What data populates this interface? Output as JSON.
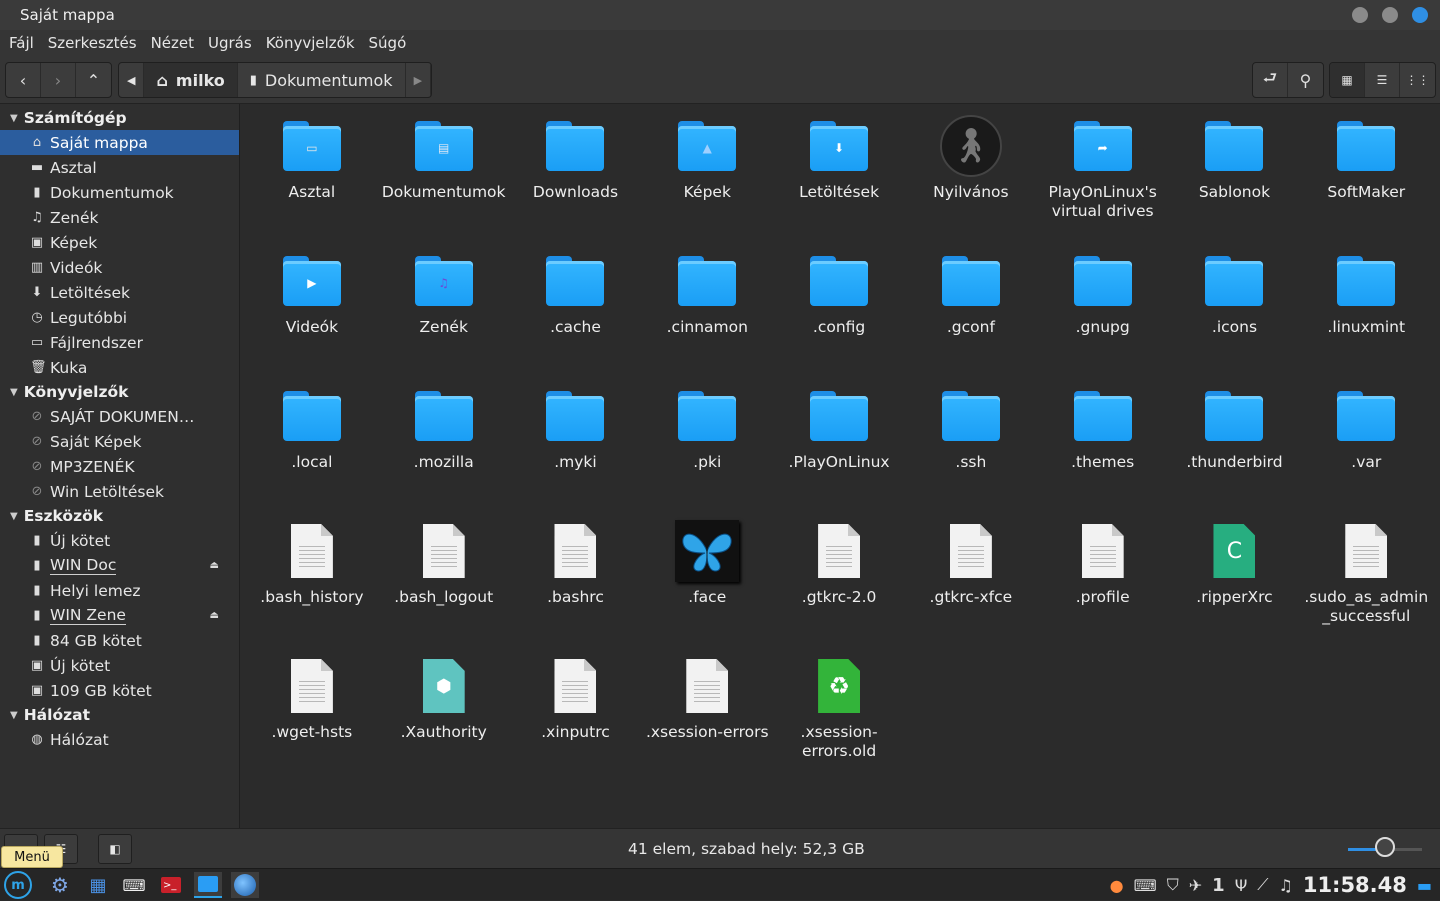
{
  "window": {
    "title": "Saját mappa"
  },
  "menu": [
    "Fájl",
    "Szerkesztés",
    "Nézet",
    "Ugrás",
    "Könyvjelzők",
    "Súgó"
  ],
  "breadcrumb": {
    "home": "milko",
    "current": "Dokumentumok"
  },
  "sidebar": {
    "computer_header": "Számítógép",
    "computer": [
      {
        "label": "Saját mappa",
        "icon": "home-icon"
      },
      {
        "label": "Asztal",
        "icon": "desktop-icon"
      },
      {
        "label": "Dokumentumok",
        "icon": "document-icon"
      },
      {
        "label": "Zenék",
        "icon": "music-icon"
      },
      {
        "label": "Képek",
        "icon": "image-icon"
      },
      {
        "label": "Videók",
        "icon": "video-icon"
      },
      {
        "label": "Letöltések",
        "icon": "download-icon"
      },
      {
        "label": "Legutóbbi",
        "icon": "recent-icon"
      },
      {
        "label": "Fájlrendszer",
        "icon": "drive-icon"
      },
      {
        "label": "Kuka",
        "icon": "trash-icon"
      }
    ],
    "bookmarks_header": "Könyvjelzők",
    "bookmarks": [
      "SAJÁT DOKUMEN…",
      "Saját Képek",
      "MP3ZENÉK",
      "Win Letöltések"
    ],
    "devices_header": "Eszközök",
    "devices": [
      {
        "label": "Új kötet",
        "eject": false
      },
      {
        "label": "WIN Doc",
        "eject": true
      },
      {
        "label": "Helyi lemez",
        "eject": false
      },
      {
        "label": "WIN Zene",
        "eject": true
      },
      {
        "label": "84 GB kötet",
        "eject": false
      },
      {
        "label": "Új kötet",
        "eject": false
      },
      {
        "label": "109 GB kötet",
        "eject": false
      }
    ],
    "network_header": "Hálózat",
    "network": [
      "Hálózat"
    ]
  },
  "files": [
    {
      "name": "Asztal",
      "kind": "folder",
      "emblem": "▭",
      "emblem_color": "#e8e8e8"
    },
    {
      "name": "Dokumentumok",
      "kind": "folder",
      "emblem": "▤",
      "emblem_color": "#dfe8f5"
    },
    {
      "name": "Downloads",
      "kind": "folder"
    },
    {
      "name": "Képek",
      "kind": "folder",
      "emblem": "▲",
      "emblem_color": "#9fd0ff"
    },
    {
      "name": "Letöltések",
      "kind": "folder",
      "emblem": "⬇",
      "emblem_color": "#ffffff"
    },
    {
      "name": "Nyilvános",
      "kind": "public"
    },
    {
      "name": "PlayOnLinux's virtual drives",
      "kind": "folder",
      "emblem": "➦",
      "emblem_color": "#ffffff"
    },
    {
      "name": "Sablonok",
      "kind": "folder"
    },
    {
      "name": "SoftMaker",
      "kind": "folder"
    },
    {
      "name": "Videók",
      "kind": "folder",
      "emblem": "▶",
      "emblem_color": "#ffffff"
    },
    {
      "name": "Zenék",
      "kind": "folder",
      "emblem": "♫",
      "emblem_color": "#6a4bd8"
    },
    {
      "name": ".cache",
      "kind": "folder"
    },
    {
      "name": ".cinnamon",
      "kind": "folder"
    },
    {
      "name": ".config",
      "kind": "folder"
    },
    {
      "name": ".gconf",
      "kind": "folder"
    },
    {
      "name": ".gnupg",
      "kind": "folder"
    },
    {
      "name": ".icons",
      "kind": "folder"
    },
    {
      "name": ".linuxmint",
      "kind": "folder"
    },
    {
      "name": ".local",
      "kind": "folder"
    },
    {
      "name": ".mozilla",
      "kind": "folder"
    },
    {
      "name": ".myki",
      "kind": "folder"
    },
    {
      "name": ".pki",
      "kind": "folder"
    },
    {
      "name": ".PlayOnLinux",
      "kind": "folder"
    },
    {
      "name": ".ssh",
      "kind": "folder"
    },
    {
      "name": ".themes",
      "kind": "folder"
    },
    {
      "name": ".thunderbird",
      "kind": "folder"
    },
    {
      "name": ".var",
      "kind": "folder"
    },
    {
      "name": ".bash_history",
      "kind": "doc"
    },
    {
      "name": ".bash_logout",
      "kind": "doc"
    },
    {
      "name": ".bashrc",
      "kind": "doc"
    },
    {
      "name": ".face",
      "kind": "image"
    },
    {
      "name": ".gtkrc-2.0",
      "kind": "doc"
    },
    {
      "name": ".gtkrc-xfce",
      "kind": "doc"
    },
    {
      "name": ".profile",
      "kind": "doc"
    },
    {
      "name": ".ripperXrc",
      "kind": "cfile",
      "glyph": "C"
    },
    {
      "name": ".sudo_as_admin_successful",
      "kind": "doc"
    },
    {
      "name": ".wget-hsts",
      "kind": "doc"
    },
    {
      "name": ".Xauthority",
      "kind": "xauth"
    },
    {
      "name": ".xinputrc",
      "kind": "doc"
    },
    {
      "name": ".xsession-errors",
      "kind": "doc"
    },
    {
      "name": ".xsession-errors.old",
      "kind": "recycle"
    }
  ],
  "status": {
    "text": "41 elem, szabad hely: 52,3 GB",
    "zoom_level": 0.5
  },
  "tooltip": "Menü",
  "tray": {
    "workspace": "1",
    "clock": "11:58.48"
  }
}
